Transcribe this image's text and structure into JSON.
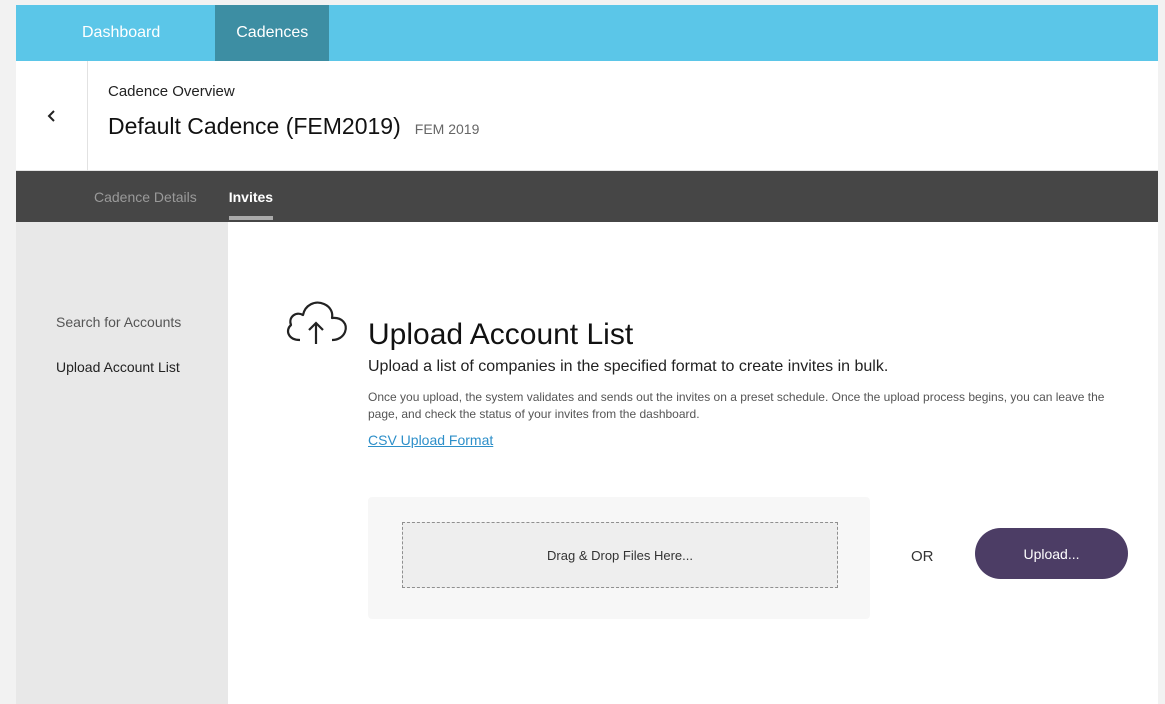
{
  "topnav": {
    "tabs": [
      {
        "label": "Dashboard"
      },
      {
        "label": "Cadences"
      }
    ]
  },
  "header": {
    "overline": "Cadence Overview",
    "title": "Default Cadence (FEM2019)",
    "title_sub": "FEM 2019"
  },
  "subnav": {
    "tabs": [
      {
        "label": "Cadence Details"
      },
      {
        "label": "Invites"
      }
    ]
  },
  "sidebar": {
    "items": [
      {
        "label": "Search for Accounts"
      },
      {
        "label": "Upload Account List"
      }
    ]
  },
  "main": {
    "heading": "Upload Account List",
    "lead": "Upload a list of companies in the specified format to create invites in bulk.",
    "description": "Once you upload, the system validates and sends out the invites on a preset schedule. Once the upload process begins, you can leave the page, and check the status of your invites from the dashboard.",
    "csv_link": "CSV Upload Format",
    "drop_zone_label": "Drag & Drop Files Here...",
    "or_label": "OR",
    "upload_button": "Upload..."
  },
  "icons": {
    "back": "chevron-left-icon",
    "upload": "cloud-upload-icon"
  },
  "colors": {
    "topnav_bg": "#5bc6e8",
    "topnav_active": "#3d8ea3",
    "subnav_bg": "#464646",
    "sidebar_bg": "#e8e8e8",
    "link": "#2d8fc9",
    "upload_button_bg": "#4c3d65"
  }
}
